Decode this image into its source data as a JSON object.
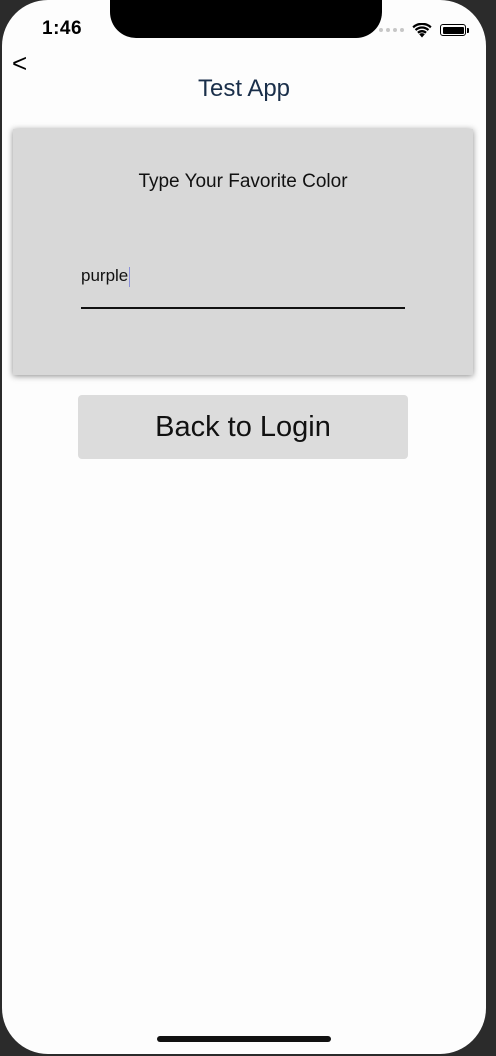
{
  "status_bar": {
    "time": "1:46",
    "icons": [
      "cellular-dots-icon",
      "wifi-icon",
      "battery-icon"
    ]
  },
  "nav": {
    "back_label": "<",
    "title": "Test App"
  },
  "form": {
    "prompt": "Type Your Favorite Color",
    "input_value": "purple"
  },
  "actions": {
    "back_to_login_label": "Back to Login"
  },
  "colors": {
    "screen_background": "#fdfdfd",
    "card_background": "#d8d8d8",
    "button_background": "#dcdcdc",
    "title_color": "#1a2f4a",
    "caret_color": "#8a90d8"
  }
}
